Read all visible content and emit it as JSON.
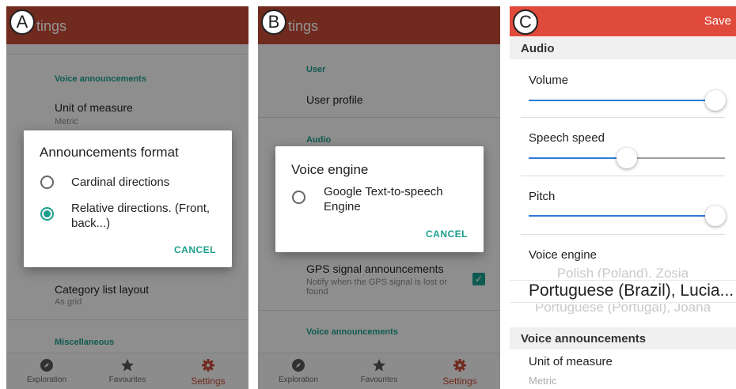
{
  "panel_a": {
    "letter": "A",
    "appbar_title": "tings",
    "voice_header": "Voice announcements",
    "unit_title": "Unit of measure",
    "unit_value": "Metric",
    "category_title": "Category list layout",
    "category_value": "As grid",
    "misc_header": "Miscellaneous",
    "dialog": {
      "title": "Announcements format",
      "options": [
        "Cardinal directions",
        "Relative directions. (Front, back...)"
      ],
      "selected_index": 1,
      "cancel": "CANCEL"
    },
    "nav": [
      "Exploration",
      "Favourites",
      "Settings"
    ]
  },
  "panel_b": {
    "letter": "B",
    "appbar_title": "tings",
    "user_header": "User",
    "user_profile": "User profile",
    "audio_header": "Audio",
    "gps_title": "GPS signal announcements",
    "gps_sub": "Notify when the GPS signal is lost or found",
    "gps_checked": true,
    "voice_header": "Voice announcements",
    "dialog": {
      "title": "Voice engine",
      "options": [
        "Google Text-to-speech Engine"
      ],
      "cancel": "CANCEL"
    },
    "nav": [
      "Exploration",
      "Favourites",
      "Settings"
    ]
  },
  "panel_c": {
    "letter": "C",
    "save": "Save",
    "audio_header": "Audio",
    "volume": {
      "label": "Volume",
      "value_fraction": 0.95
    },
    "speech_speed": {
      "label": "Speech speed",
      "value_fraction": 0.5
    },
    "pitch": {
      "label": "Pitch",
      "value_fraction": 0.95
    },
    "voice_engine_label": "Voice engine",
    "picker": [
      "Polish (Poland), Zosia",
      "Portuguese (Brazil), Lucia...",
      "Portuguese (Portugal), Joana"
    ],
    "voice_header": "Voice announcements",
    "unit_title": "Unit of measure",
    "unit_value": "Metric"
  },
  "colors": {
    "appbar": "#c24a35",
    "accent": "#1d9e8c",
    "c_bar": "#e04a3a",
    "slider": "#2b7ad6"
  }
}
